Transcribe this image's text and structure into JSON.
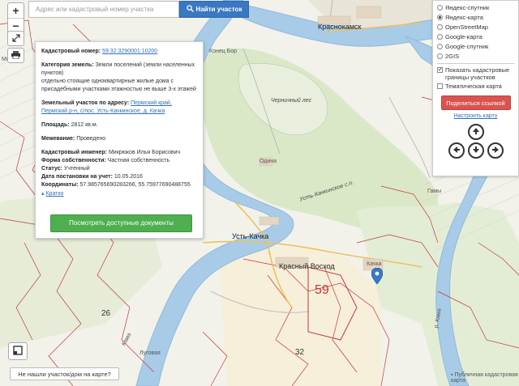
{
  "search": {
    "placeholder": "Адрес или кадастровый номер участка",
    "button_label": "Найти участок"
  },
  "zoom": {
    "plus": "+",
    "minus": "−"
  },
  "map_labels": {
    "krasnokamsk": "Краснокамск",
    "ust_kachka": "Усть-Качка",
    "krasny_voskhod": "Красный Восход",
    "kachka": "Качка",
    "odina": "Одина",
    "chernichny_les": "Черничный лес",
    "ust_kachkinskoe": "Усть-Качкинское с.п.",
    "lugovaya": "Луговая",
    "gamy": "Гамы",
    "konets_bor": "Конец Бор",
    "mochevo": "Мошево",
    "kama": "р. Кама",
    "kama_left": "Кама",
    "region_num": "59",
    "num_26": "26",
    "num_32": "32"
  },
  "card": {
    "cadastral_number_label": "Кадастровый номер:",
    "cadastral_number_value": "59:32:3290001:10200",
    "land_category_label": "Категория земель:",
    "land_category_value": "Земли поселений (земли населенных пунктов)",
    "usage_text": "отдельно стоящие одноквартирные жилые дома с присадебными участками этажностью не выше 3-х этажей",
    "address_label": "Земельный участок по адресу:",
    "address_value": "Пермский край, Пермский р-н, с/пос. Усть-Качкинское, д. Качка",
    "area_label": "Площадь:",
    "area_value": "2812 кв.м.",
    "survey_label": "Межевание:",
    "survey_value": "Проведено",
    "engineer_label": "Кадастровый инженер:",
    "engineer_value": "Микрюков Илья Борисович",
    "ownership_label": "Форма собственности:",
    "ownership_value": "Частная собственность",
    "status_label": "Статус:",
    "status_value": "Учтенный",
    "registered_label": "Дата постановки на учет:",
    "registered_value": "10.05.2016",
    "coords_label": "Координаты:",
    "coords_value": "57.985765690283266, 55.75977690488755",
    "brief_label": "Кратко",
    "docs_button": "Посмотреть доступные документы"
  },
  "layers": {
    "options": [
      {
        "label": "Яндекс-спутник",
        "selected": false
      },
      {
        "label": "Яндекс-карта",
        "selected": true
      },
      {
        "label": "OpenStreetMap",
        "selected": false
      },
      {
        "label": "Google-карта",
        "selected": false
      },
      {
        "label": "Google-спутник",
        "selected": false
      },
      {
        "label": "2GIS",
        "selected": false
      }
    ],
    "show_cadastral": {
      "label": "Показать кадастровые границы участков",
      "checked": true
    },
    "thematic_map": {
      "label": "Тематическая карта",
      "checked": false
    },
    "share_button": "Поделиться ссылкой",
    "reset_link": "Настроить карту"
  },
  "bottom": {
    "not_found": "Не нашли участок/дом на карте?",
    "source": "Публичная кадастровая карта"
  },
  "colors": {
    "accent": "#3a78c2",
    "docs_green": "#4fae4f",
    "share_red": "#d9534f",
    "river": "#a8cce8",
    "boundary": "#c03a3a"
  }
}
